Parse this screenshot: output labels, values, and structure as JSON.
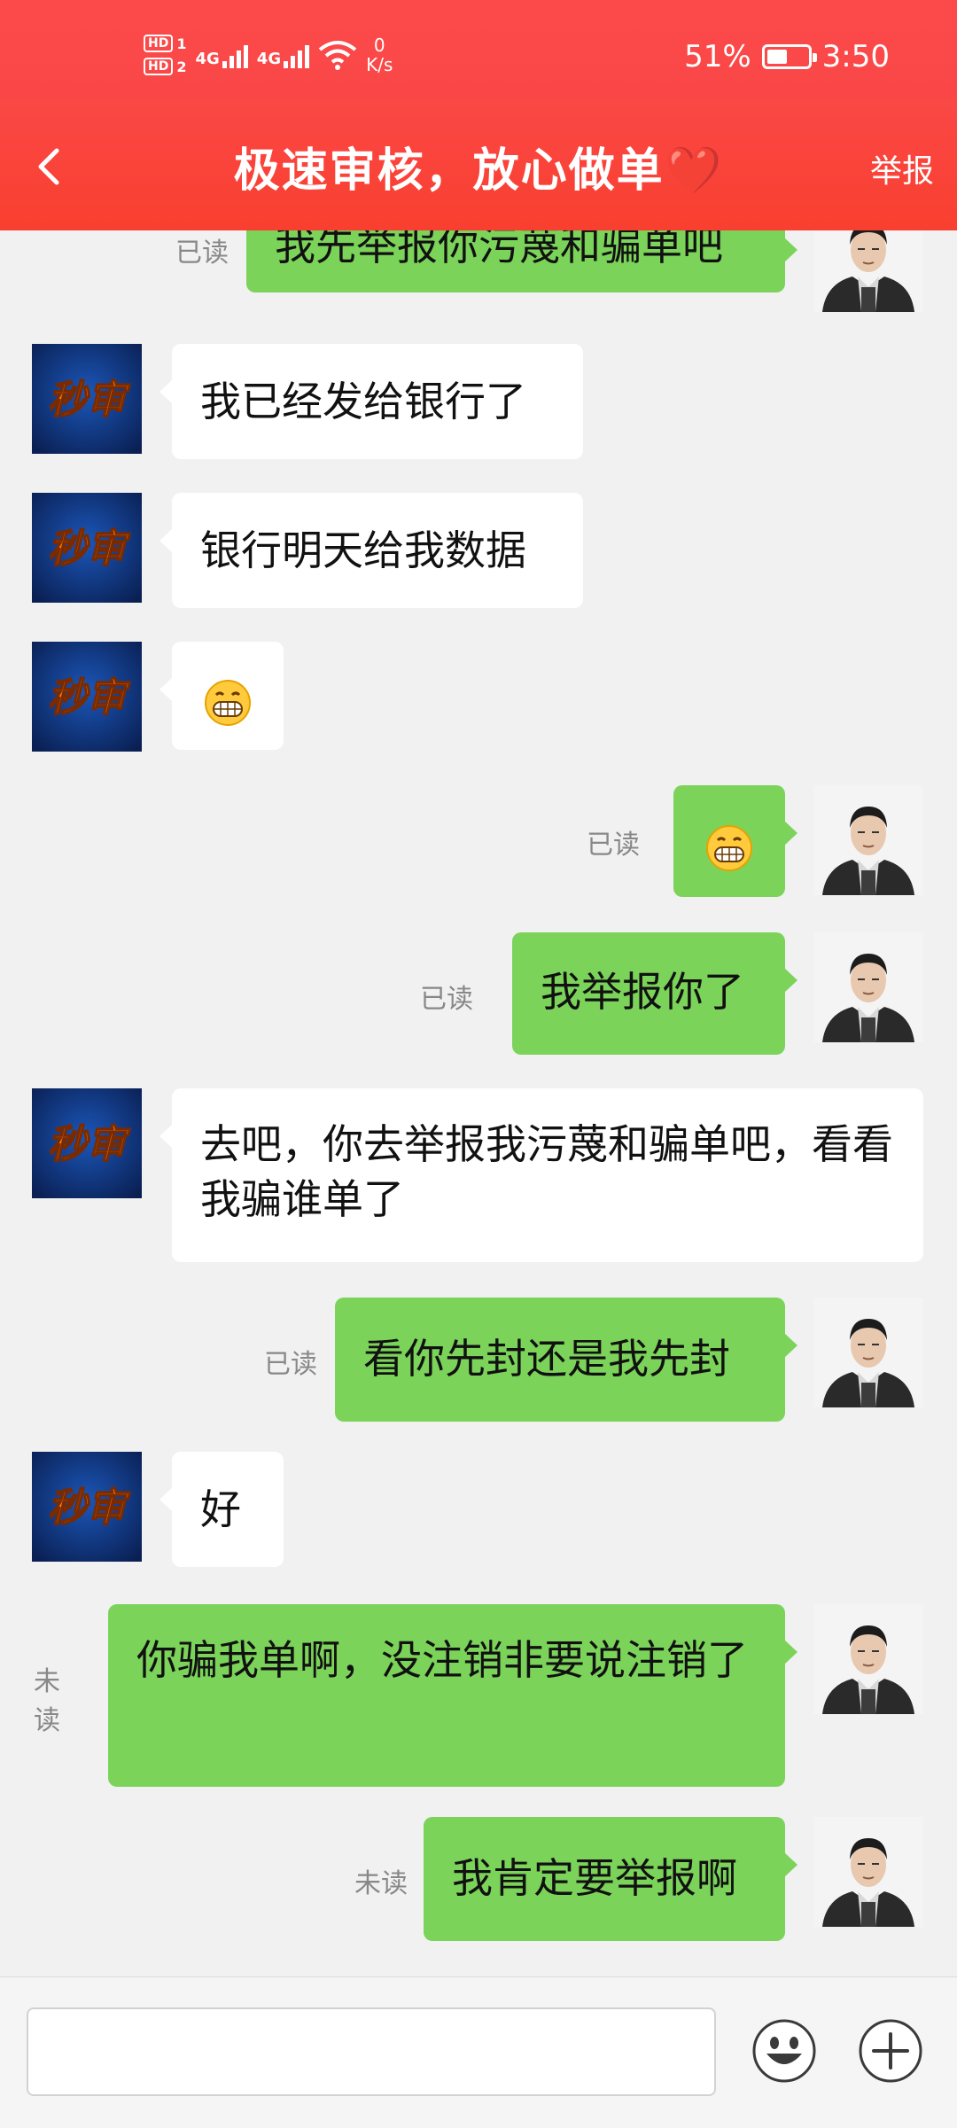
{
  "status_bar": {
    "hd1": "HD",
    "hd1_n": "1",
    "hd2": "HD",
    "hd2_n": "2",
    "net1": "4G",
    "net2": "4G",
    "speed_value": "0",
    "speed_unit": "K/s",
    "battery_text": "51%",
    "battery_level": 0.51,
    "time": "3:50"
  },
  "header": {
    "title": "极速审核，放心做单❤️",
    "report_label": "举报"
  },
  "chat": {
    "contact_avatar_text": "秒审",
    "messages": [
      {
        "side": "right",
        "text": "我先举报你污蔑和骗单吧",
        "status": "已读"
      },
      {
        "side": "left",
        "text": "我已经发给银行了"
      },
      {
        "side": "left",
        "text": "银行明天给我数据"
      },
      {
        "side": "left",
        "emoji": "grin"
      },
      {
        "side": "right",
        "emoji": "grin",
        "status": "已读"
      },
      {
        "side": "right",
        "text": "我举报你了",
        "status": "已读"
      },
      {
        "side": "left",
        "text": "去吧，你去举报我污蔑和骗单吧，看看我骗谁单了"
      },
      {
        "side": "right",
        "text": "看你先封还是我先封",
        "status": "已读"
      },
      {
        "side": "left",
        "text": "好"
      },
      {
        "side": "right",
        "text": "你骗我单啊，没注销非要说注销了",
        "status": "未读"
      },
      {
        "side": "right",
        "text": "我肯定要举报啊",
        "status": "未读"
      }
    ]
  },
  "input": {
    "value": ""
  },
  "icons": {
    "back": "chevron-left-icon",
    "emoji": "smiley-icon",
    "more": "plus-icon"
  },
  "colors": {
    "header_red": "#f94434",
    "sent_bubble": "#7bd35a",
    "received_bubble": "#ffffff",
    "background": "#f1f1f1"
  }
}
